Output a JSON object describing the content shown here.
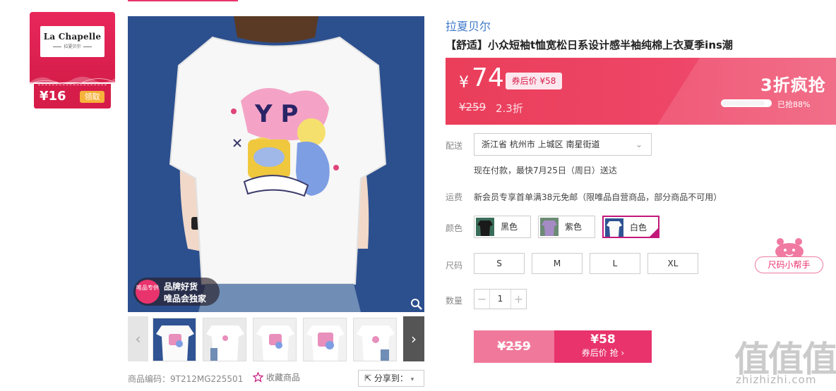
{
  "brand_card": {
    "logo_name": "La Chapelle",
    "logo_sub": "拉夏贝尔",
    "coupon_amount": "¥16",
    "coupon_button": "领取"
  },
  "main_image": {
    "badge_circle": "唯品专供",
    "badge_line1": "品牌好货",
    "badge_line2": "唯品会独家",
    "zoom_icon": "magnifier-icon"
  },
  "thumbnails": {
    "count": 5,
    "prev_icon": "chevron-left-icon",
    "next_icon": "chevron-right-icon"
  },
  "meta": {
    "product_code": "商品编码：9T212MG225501",
    "favorite_label": "收藏商品",
    "share_label": "分享到："
  },
  "product": {
    "brand": "拉夏贝尔",
    "title": "【舒适】小众短袖t恤宽松日系设计感半袖纯棉上衣夏季ins潮"
  },
  "price_bar": {
    "currency": "¥",
    "price": "74",
    "after_coupon": "券后价 ¥58",
    "original_price": "¥259",
    "discount": "2.3折",
    "flash_label": "3折疯抢",
    "sold_text": "已抢88%",
    "sold_percent": 88
  },
  "delivery": {
    "label": "配送",
    "location": "浙江省 杭州市 上城区 南星街道",
    "eta": "现在付款，最快7月25日（周日）送达"
  },
  "shipping": {
    "label": "运费",
    "text": "新会员专享首单满38元免邮（限唯品自营商品，部分商品不可用）"
  },
  "colors": {
    "label": "颜色",
    "options": [
      "黑色",
      "紫色",
      "白色"
    ],
    "selected": "白色"
  },
  "sizes": {
    "label": "尺码",
    "options": [
      "S",
      "M",
      "L",
      "XL"
    ]
  },
  "quantity": {
    "label": "数量",
    "minus": "−",
    "value": "1",
    "plus": "+"
  },
  "buy": {
    "original": "¥259",
    "price": "¥58",
    "action": "券后价 抢 ›"
  },
  "size_helper": {
    "label": "尺码小帮手"
  },
  "watermark": {
    "chars": "值值值",
    "url": "zhizhizhi.com"
  },
  "colors_palette": {
    "accent": "#e8336d",
    "price_bar": "#ee4668",
    "link": "#3e78c8",
    "brand_red": "#d61d4a"
  }
}
